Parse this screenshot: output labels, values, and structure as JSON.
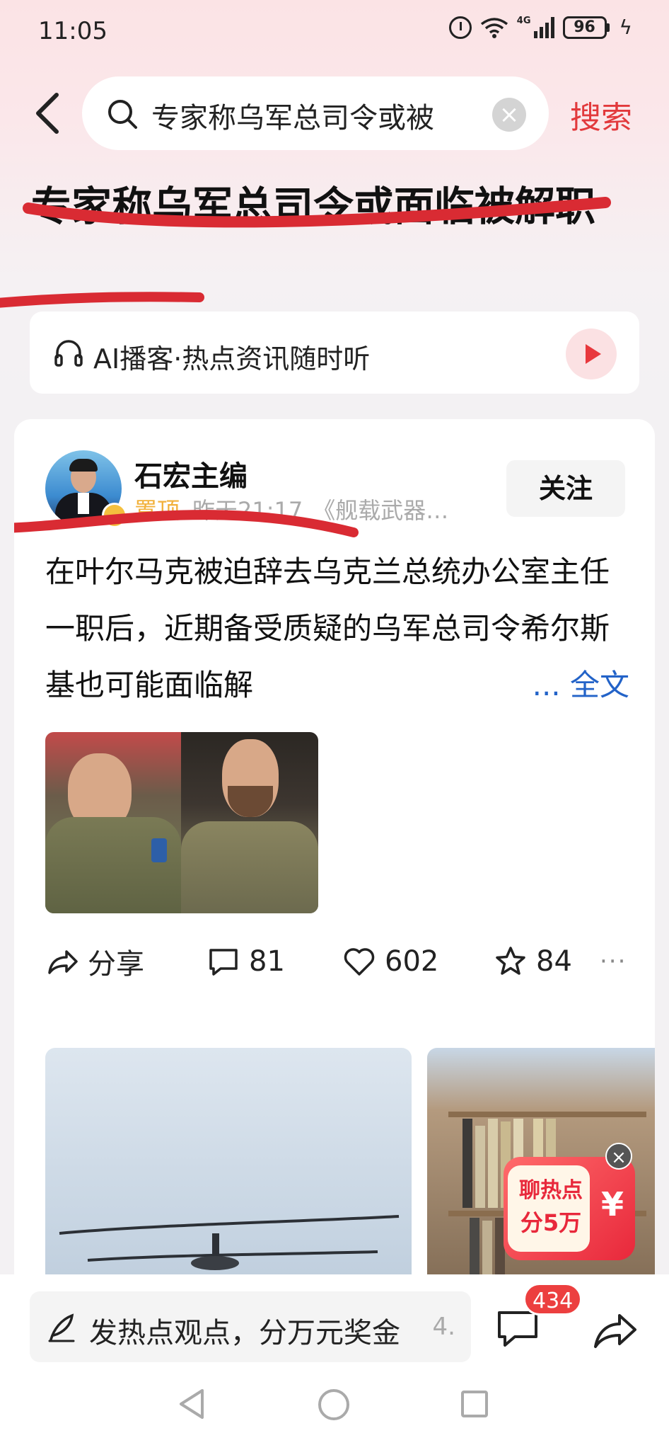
{
  "status_bar": {
    "time": "11:05",
    "network": "4G",
    "battery": "96"
  },
  "search": {
    "query": "专家称乌军总司令或被",
    "button_label": "搜索"
  },
  "article": {
    "headline": "专家称乌军总司令或面临被解职",
    "podcast_label": "AI播客·热点资讯随时听"
  },
  "post": {
    "author": "石宏主编",
    "tag": "置顶",
    "time": "昨天21:17",
    "source": "《舰载武器…",
    "follow_label": "关注",
    "text": "在叶尔马克被迫辞去乌克兰总统办公室主任一职后，近期备受质疑的乌军总司令希尔斯基也可能面临解",
    "more_label": "... 全文",
    "actions": {
      "share_label": "分享",
      "comment_count": "81",
      "like_count": "602",
      "favorite_count": "84",
      "more": "···"
    }
  },
  "promo": {
    "line1": "聊热点",
    "line2": "分5万",
    "symbol": "¥",
    "close": "×"
  },
  "bottom_bar": {
    "compose_placeholder": "发热点观点，分万元奖金",
    "compose_count": "4.",
    "comment_badge": "434"
  },
  "colors": {
    "accent": "#e2393c",
    "link": "#2363c8",
    "tag": "#f2b13b",
    "strike": "#d92b33"
  }
}
